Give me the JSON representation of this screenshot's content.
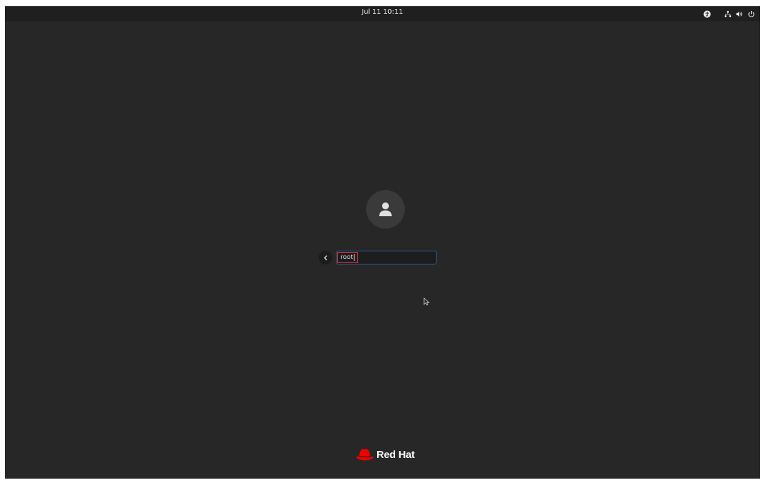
{
  "topbar": {
    "clock": "Jul 11  10:11",
    "tray_icons": [
      "accessibility-icon",
      "network-icon",
      "volume-icon",
      "power-icon"
    ]
  },
  "login": {
    "avatar_icon": "user-icon",
    "back_icon": "chevron-left-icon",
    "username_value": "root"
  },
  "brand": {
    "logo_icon": "red-hat-logo-icon",
    "name": "Red Hat"
  },
  "colors": {
    "background": "#272727",
    "input_focus_border": "#2e5f9e",
    "highlight_box": "#d0303a",
    "brand_red": "#ee0000"
  }
}
